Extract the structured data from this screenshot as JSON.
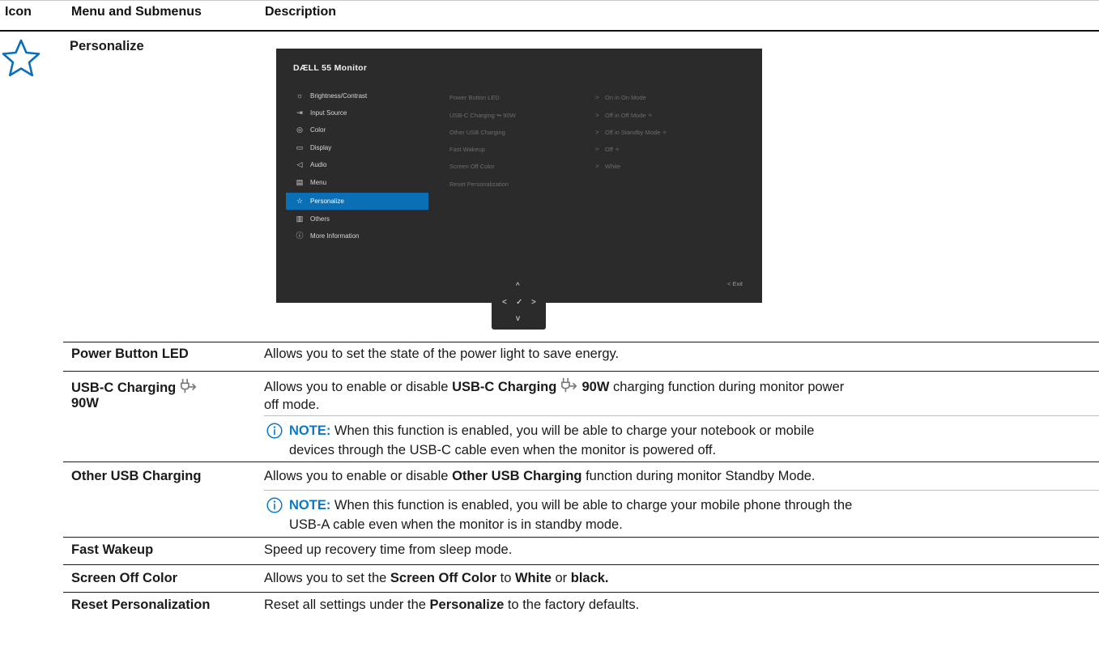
{
  "table_header": {
    "col_icon": "Icon",
    "col_menu": "Menu and Submenus",
    "col_desc": "Description"
  },
  "section": {
    "icon": "star-icon",
    "title": "Personalize"
  },
  "osd": {
    "brand": "DÆLL 55 Monitor",
    "menu_items": [
      {
        "icon": "sun-icon",
        "label": "Brightness/Contrast"
      },
      {
        "icon": "input-source-icon",
        "label": "Input Source"
      },
      {
        "icon": "palette-icon",
        "label": "Color"
      },
      {
        "icon": "display-icon",
        "label": "Display"
      },
      {
        "icon": "speaker-icon",
        "label": "Audio"
      },
      {
        "icon": "menu-icon",
        "label": "Menu"
      },
      {
        "icon": "star-icon",
        "label": "Personalize",
        "selected": true
      },
      {
        "icon": "others-icon",
        "label": "Others"
      },
      {
        "icon": "info-icon",
        "label": "More Information"
      }
    ],
    "submenu": [
      {
        "label": "Power Button LED",
        "arrow": ">",
        "value": "On in On Mode"
      },
      {
        "label": "USB-C Charging ↬ 90W",
        "arrow": ">",
        "value": "Off in Off Mode ✧"
      },
      {
        "label": "Other USB Charging",
        "arrow": ">",
        "value": "Off in Standby Mode ✧"
      },
      {
        "label": "Fast Wakeup",
        "arrow": ">",
        "value": "Off ✧"
      },
      {
        "label": "Screen Off Color",
        "arrow": ">",
        "value": "White"
      },
      {
        "label": "Reset Personalization",
        "arrow": "",
        "value": ""
      }
    ],
    "exit_label": "<  Exit",
    "nav": {
      "up": "^",
      "left": "<",
      "ok": "✓",
      "right": ">",
      "down": "v"
    }
  },
  "rows": [
    {
      "label": "Power Button LED",
      "desc": "Allows you to set the state of the power light to save energy."
    },
    {
      "label_line1": "USB-C Charging",
      "label_line2": "90W",
      "desc_pre": "Allows you to enable or disable ",
      "desc_bold1": "USB-C Charging",
      "desc_bold2": "90W",
      "desc_post": " charging function during monitor power",
      "desc_line2": "off mode.",
      "note_label": "NOTE:",
      "note_line1": " When this function is enabled, you will be able to charge your notebook or mobile",
      "note_line2": "devices through the USB-C cable even when the monitor is powered off."
    },
    {
      "label": "Other USB Charging",
      "desc_pre": "Allows you to enable or disable ",
      "desc_bold": "Other USB Charging",
      "desc_post": " function during monitor Standby Mode.",
      "note_label": "NOTE:",
      "note_line1": " When this function is enabled, you will be able to charge your mobile phone through the",
      "note_line2": "USB-A cable even when the monitor is in standby mode."
    },
    {
      "label": "Fast Wakeup",
      "desc": "Speed up recovery time from sleep mode."
    },
    {
      "label": "Screen Off Color",
      "desc_pre": "Allows you to set the ",
      "desc_bold1": "Screen Off Color",
      "desc_mid1": " to ",
      "desc_bold2": "White",
      "desc_mid2": " or ",
      "desc_bold3": "black."
    },
    {
      "label": "Reset Personalization",
      "desc_pre": "Reset all settings under the ",
      "desc_bold": "Personalize",
      "desc_post": " to the factory defaults."
    }
  ]
}
